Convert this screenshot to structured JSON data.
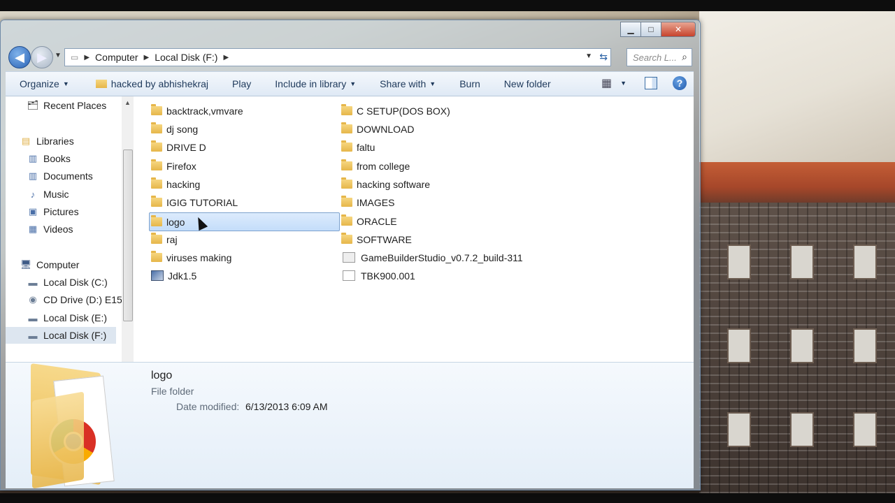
{
  "window": {
    "caption_buttons": {
      "minimize": "▁",
      "maximize": "□",
      "close": "✕"
    }
  },
  "address_bar": {
    "crumbs": [
      "Computer",
      "Local Disk (F:)"
    ],
    "search_placeholder": "Search L..."
  },
  "toolbar": {
    "organize": "Organize",
    "hacked": "hacked by abhishekraj",
    "play": "Play",
    "include": "Include in library",
    "share": "Share with",
    "burn": "Burn",
    "new_folder": "New folder",
    "help": "?"
  },
  "nav": {
    "recent": "Recent Places",
    "libraries": "Libraries",
    "books": "Books",
    "documents": "Documents",
    "music": "Music",
    "pictures": "Pictures",
    "videos": "Videos",
    "computer": "Computer",
    "disk_c": "Local Disk (C:)",
    "cd": "CD Drive (D:) E15",
    "disk_e": "Local Disk (E:)",
    "disk_f": "Local Disk (F:)"
  },
  "files": {
    "col1": [
      "backtrack,vmvare",
      "dj song",
      "DRIVE D",
      "Firefox",
      "hacking",
      "IGIG TUTORIAL",
      "logo",
      "raj",
      "viruses making",
      "Jdk1.5"
    ],
    "col2": [
      "C SETUP(DOS BOX)",
      "DOWNLOAD",
      "faltu",
      "from college",
      "hacking software",
      "IMAGES",
      "ORACLE",
      "SOFTWARE",
      "GameBuilderStudio_v0.7.2_build-311",
      "TBK900.001"
    ]
  },
  "details": {
    "name": "logo",
    "type": "File folder",
    "date_label": "Date modified:",
    "date_value": "6/13/2013 6:09 AM"
  }
}
